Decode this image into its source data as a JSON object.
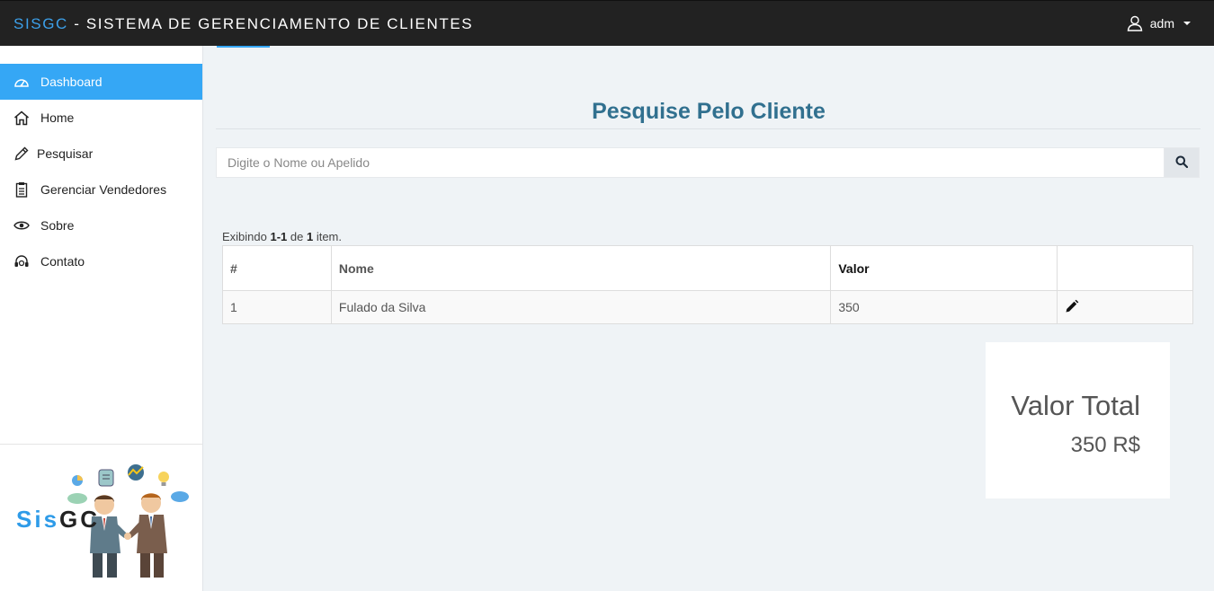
{
  "header": {
    "brand_accent": "SISGC",
    "brand_rest": " - SISTEMA DE GERENCIAMENTO DE CLIENTES",
    "user_name": "adm",
    "accent_color": "#3ca0ea"
  },
  "sidebar": {
    "items": [
      {
        "label": "Dashboard",
        "icon": "dashboard-icon",
        "active": true
      },
      {
        "label": "Home",
        "icon": "home-icon"
      },
      {
        "label": "Pesquisar",
        "icon": "pencil-icon"
      },
      {
        "label": "Gerenciar Vendedores",
        "icon": "clipboard-icon"
      },
      {
        "label": "Sobre",
        "icon": "eye-icon"
      },
      {
        "label": "Contato",
        "icon": "headset-icon"
      }
    ],
    "logo": {
      "part1": "Sis",
      "part2": "GC"
    }
  },
  "main": {
    "title": "Pesquise Pelo Cliente",
    "search": {
      "placeholder": "Digite o Nome ou Apelido",
      "value": "",
      "button_icon": "search-icon"
    },
    "summary": {
      "prefix": "Exibindo ",
      "range": "1-1",
      "middle": " de ",
      "count": "1",
      "suffix": " item."
    },
    "table": {
      "headers": [
        "#",
        "Nome",
        "Valor",
        ""
      ],
      "rows": [
        {
          "num": "1",
          "nome": "Fulado da Silva",
          "valor": "350",
          "action_icon": "pencil-icon"
        }
      ]
    },
    "total": {
      "label": "Valor Total",
      "value": "350 R$"
    }
  }
}
